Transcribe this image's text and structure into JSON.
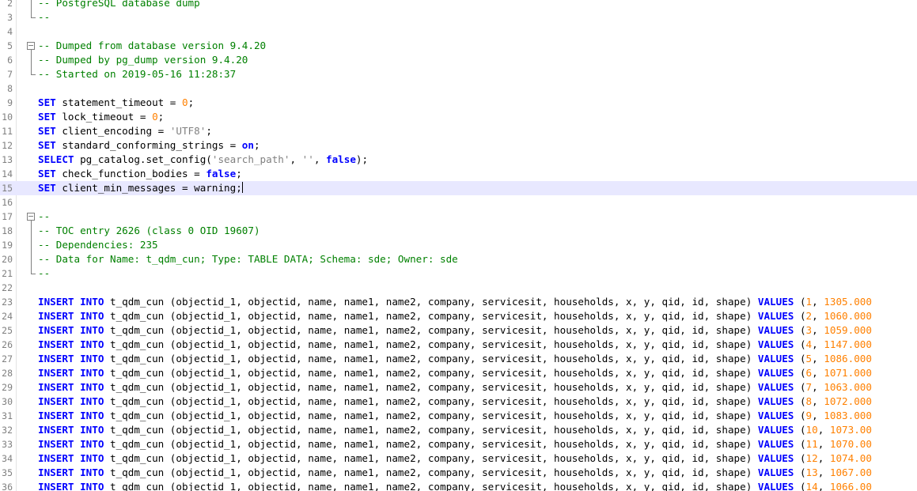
{
  "editor": {
    "language": "sql",
    "current_line": 15,
    "colors": {
      "keyword": "#0000ff",
      "comment": "#008000",
      "number": "#ff8000",
      "string": "#808080",
      "current_line_bg": "#e8e8ff",
      "line_number": "#808080"
    },
    "lines": [
      {
        "n": "2",
        "fold": "line",
        "tokens": [
          {
            "t": "-- PostgreSQL database dump",
            "c": "cm"
          }
        ]
      },
      {
        "n": "3",
        "fold": "end",
        "tokens": [
          {
            "t": "--",
            "c": "cm"
          }
        ]
      },
      {
        "n": "4",
        "fold": "",
        "tokens": []
      },
      {
        "n": "5",
        "fold": "box",
        "tokens": [
          {
            "t": "-- Dumped from database version 9.4.20",
            "c": "cm"
          }
        ]
      },
      {
        "n": "6",
        "fold": "line",
        "tokens": [
          {
            "t": "-- Dumped by pg_dump version 9.4.20",
            "c": "cm"
          }
        ]
      },
      {
        "n": "7",
        "fold": "end",
        "tokens": [
          {
            "t": "-- Started on 2019-05-16 11:28:37",
            "c": "cm"
          }
        ]
      },
      {
        "n": "8",
        "fold": "",
        "tokens": []
      },
      {
        "n": "9",
        "fold": "",
        "tokens": [
          {
            "t": "SET",
            "c": "kw"
          },
          {
            "t": " statement_timeout = ",
            "c": "pl"
          },
          {
            "t": "0",
            "c": "num"
          },
          {
            "t": ";",
            "c": "pl"
          }
        ]
      },
      {
        "n": "10",
        "fold": "",
        "tokens": [
          {
            "t": "SET",
            "c": "kw"
          },
          {
            "t": " lock_timeout = ",
            "c": "pl"
          },
          {
            "t": "0",
            "c": "num"
          },
          {
            "t": ";",
            "c": "pl"
          }
        ]
      },
      {
        "n": "11",
        "fold": "",
        "tokens": [
          {
            "t": "SET",
            "c": "kw"
          },
          {
            "t": " client_encoding = ",
            "c": "pl"
          },
          {
            "t": "'UTF8'",
            "c": "str"
          },
          {
            "t": ";",
            "c": "pl"
          }
        ]
      },
      {
        "n": "12",
        "fold": "",
        "tokens": [
          {
            "t": "SET",
            "c": "kw"
          },
          {
            "t": " standard_conforming_strings = ",
            "c": "pl"
          },
          {
            "t": "on",
            "c": "kw"
          },
          {
            "t": ";",
            "c": "pl"
          }
        ]
      },
      {
        "n": "13",
        "fold": "",
        "tokens": [
          {
            "t": "SELECT",
            "c": "kw"
          },
          {
            "t": " pg_catalog.set_config(",
            "c": "pl"
          },
          {
            "t": "'search_path'",
            "c": "str"
          },
          {
            "t": ", ",
            "c": "pl"
          },
          {
            "t": "''",
            "c": "str"
          },
          {
            "t": ", ",
            "c": "pl"
          },
          {
            "t": "false",
            "c": "kw"
          },
          {
            "t": ");",
            "c": "pl"
          }
        ]
      },
      {
        "n": "14",
        "fold": "",
        "tokens": [
          {
            "t": "SET",
            "c": "kw"
          },
          {
            "t": " check_function_bodies = ",
            "c": "pl"
          },
          {
            "t": "false",
            "c": "kw"
          },
          {
            "t": ";",
            "c": "pl"
          }
        ]
      },
      {
        "n": "15",
        "fold": "",
        "tokens": [
          {
            "t": "SET",
            "c": "kw"
          },
          {
            "t": " client_min_messages = warning;",
            "c": "pl"
          }
        ]
      },
      {
        "n": "16",
        "fold": "",
        "tokens": []
      },
      {
        "n": "17",
        "fold": "box",
        "tokens": [
          {
            "t": "--",
            "c": "cm"
          }
        ]
      },
      {
        "n": "18",
        "fold": "line",
        "tokens": [
          {
            "t": "-- TOC entry 2626 (class 0 OID 19607)",
            "c": "cm"
          }
        ]
      },
      {
        "n": "19",
        "fold": "line",
        "tokens": [
          {
            "t": "-- Dependencies: 235",
            "c": "cm"
          }
        ]
      },
      {
        "n": "20",
        "fold": "line",
        "tokens": [
          {
            "t": "-- Data for Name: t_qdm_cun; Type: TABLE DATA; Schema: sde; Owner: sde",
            "c": "cm"
          }
        ]
      },
      {
        "n": "21",
        "fold": "end",
        "tokens": [
          {
            "t": "--",
            "c": "cm"
          }
        ]
      },
      {
        "n": "22",
        "fold": "",
        "tokens": []
      },
      {
        "n": "23",
        "fold": "",
        "tokens": [
          {
            "t": "INSERT INTO",
            "c": "kw"
          },
          {
            "t": " t_qdm_cun (objectid_1, objectid, name, name1, name2, company, servicesit, households, x, y, qid, id, shape) ",
            "c": "pl"
          },
          {
            "t": "VALUES",
            "c": "kw"
          },
          {
            "t": " (",
            "c": "pl"
          },
          {
            "t": "1",
            "c": "num"
          },
          {
            "t": ", ",
            "c": "pl"
          },
          {
            "t": "1305.000",
            "c": "num"
          }
        ]
      },
      {
        "n": "24",
        "fold": "",
        "tokens": [
          {
            "t": "INSERT INTO",
            "c": "kw"
          },
          {
            "t": " t_qdm_cun (objectid_1, objectid, name, name1, name2, company, servicesit, households, x, y, qid, id, shape) ",
            "c": "pl"
          },
          {
            "t": "VALUES",
            "c": "kw"
          },
          {
            "t": " (",
            "c": "pl"
          },
          {
            "t": "2",
            "c": "num"
          },
          {
            "t": ", ",
            "c": "pl"
          },
          {
            "t": "1060.000",
            "c": "num"
          }
        ]
      },
      {
        "n": "25",
        "fold": "",
        "tokens": [
          {
            "t": "INSERT INTO",
            "c": "kw"
          },
          {
            "t": " t_qdm_cun (objectid_1, objectid, name, name1, name2, company, servicesit, households, x, y, qid, id, shape) ",
            "c": "pl"
          },
          {
            "t": "VALUES",
            "c": "kw"
          },
          {
            "t": " (",
            "c": "pl"
          },
          {
            "t": "3",
            "c": "num"
          },
          {
            "t": ", ",
            "c": "pl"
          },
          {
            "t": "1059.000",
            "c": "num"
          }
        ]
      },
      {
        "n": "26",
        "fold": "",
        "tokens": [
          {
            "t": "INSERT INTO",
            "c": "kw"
          },
          {
            "t": " t_qdm_cun (objectid_1, objectid, name, name1, name2, company, servicesit, households, x, y, qid, id, shape) ",
            "c": "pl"
          },
          {
            "t": "VALUES",
            "c": "kw"
          },
          {
            "t": " (",
            "c": "pl"
          },
          {
            "t": "4",
            "c": "num"
          },
          {
            "t": ", ",
            "c": "pl"
          },
          {
            "t": "1147.000",
            "c": "num"
          }
        ]
      },
      {
        "n": "27",
        "fold": "",
        "tokens": [
          {
            "t": "INSERT INTO",
            "c": "kw"
          },
          {
            "t": " t_qdm_cun (objectid_1, objectid, name, name1, name2, company, servicesit, households, x, y, qid, id, shape) ",
            "c": "pl"
          },
          {
            "t": "VALUES",
            "c": "kw"
          },
          {
            "t": " (",
            "c": "pl"
          },
          {
            "t": "5",
            "c": "num"
          },
          {
            "t": ", ",
            "c": "pl"
          },
          {
            "t": "1086.000",
            "c": "num"
          }
        ]
      },
      {
        "n": "28",
        "fold": "",
        "tokens": [
          {
            "t": "INSERT INTO",
            "c": "kw"
          },
          {
            "t": " t_qdm_cun (objectid_1, objectid, name, name1, name2, company, servicesit, households, x, y, qid, id, shape) ",
            "c": "pl"
          },
          {
            "t": "VALUES",
            "c": "kw"
          },
          {
            "t": " (",
            "c": "pl"
          },
          {
            "t": "6",
            "c": "num"
          },
          {
            "t": ", ",
            "c": "pl"
          },
          {
            "t": "1071.000",
            "c": "num"
          }
        ]
      },
      {
        "n": "29",
        "fold": "",
        "tokens": [
          {
            "t": "INSERT INTO",
            "c": "kw"
          },
          {
            "t": " t_qdm_cun (objectid_1, objectid, name, name1, name2, company, servicesit, households, x, y, qid, id, shape) ",
            "c": "pl"
          },
          {
            "t": "VALUES",
            "c": "kw"
          },
          {
            "t": " (",
            "c": "pl"
          },
          {
            "t": "7",
            "c": "num"
          },
          {
            "t": ", ",
            "c": "pl"
          },
          {
            "t": "1063.000",
            "c": "num"
          }
        ]
      },
      {
        "n": "30",
        "fold": "",
        "tokens": [
          {
            "t": "INSERT INTO",
            "c": "kw"
          },
          {
            "t": " t_qdm_cun (objectid_1, objectid, name, name1, name2, company, servicesit, households, x, y, qid, id, shape) ",
            "c": "pl"
          },
          {
            "t": "VALUES",
            "c": "kw"
          },
          {
            "t": " (",
            "c": "pl"
          },
          {
            "t": "8",
            "c": "num"
          },
          {
            "t": ", ",
            "c": "pl"
          },
          {
            "t": "1072.000",
            "c": "num"
          }
        ]
      },
      {
        "n": "31",
        "fold": "",
        "tokens": [
          {
            "t": "INSERT INTO",
            "c": "kw"
          },
          {
            "t": " t_qdm_cun (objectid_1, objectid, name, name1, name2, company, servicesit, households, x, y, qid, id, shape) ",
            "c": "pl"
          },
          {
            "t": "VALUES",
            "c": "kw"
          },
          {
            "t": " (",
            "c": "pl"
          },
          {
            "t": "9",
            "c": "num"
          },
          {
            "t": ", ",
            "c": "pl"
          },
          {
            "t": "1083.000",
            "c": "num"
          }
        ]
      },
      {
        "n": "32",
        "fold": "",
        "tokens": [
          {
            "t": "INSERT INTO",
            "c": "kw"
          },
          {
            "t": " t_qdm_cun (objectid_1, objectid, name, name1, name2, company, servicesit, households, x, y, qid, id, shape) ",
            "c": "pl"
          },
          {
            "t": "VALUES",
            "c": "kw"
          },
          {
            "t": " (",
            "c": "pl"
          },
          {
            "t": "10",
            "c": "num"
          },
          {
            "t": ", ",
            "c": "pl"
          },
          {
            "t": "1073.00",
            "c": "num"
          }
        ]
      },
      {
        "n": "33",
        "fold": "",
        "tokens": [
          {
            "t": "INSERT INTO",
            "c": "kw"
          },
          {
            "t": " t_qdm_cun (objectid_1, objectid, name, name1, name2, company, servicesit, households, x, y, qid, id, shape) ",
            "c": "pl"
          },
          {
            "t": "VALUES",
            "c": "kw"
          },
          {
            "t": " (",
            "c": "pl"
          },
          {
            "t": "11",
            "c": "num"
          },
          {
            "t": ", ",
            "c": "pl"
          },
          {
            "t": "1070.00",
            "c": "num"
          }
        ]
      },
      {
        "n": "34",
        "fold": "",
        "tokens": [
          {
            "t": "INSERT INTO",
            "c": "kw"
          },
          {
            "t": " t_qdm_cun (objectid_1, objectid, name, name1, name2, company, servicesit, households, x, y, qid, id, shape) ",
            "c": "pl"
          },
          {
            "t": "VALUES",
            "c": "kw"
          },
          {
            "t": " (",
            "c": "pl"
          },
          {
            "t": "12",
            "c": "num"
          },
          {
            "t": ", ",
            "c": "pl"
          },
          {
            "t": "1074.00",
            "c": "num"
          }
        ]
      },
      {
        "n": "35",
        "fold": "",
        "tokens": [
          {
            "t": "INSERT INTO",
            "c": "kw"
          },
          {
            "t": " t_qdm_cun (objectid_1, objectid, name, name1, name2, company, servicesit, households, x, y, qid, id, shape) ",
            "c": "pl"
          },
          {
            "t": "VALUES",
            "c": "kw"
          },
          {
            "t": " (",
            "c": "pl"
          },
          {
            "t": "13",
            "c": "num"
          },
          {
            "t": ", ",
            "c": "pl"
          },
          {
            "t": "1067.00",
            "c": "num"
          }
        ]
      },
      {
        "n": "36",
        "fold": "",
        "tokens": [
          {
            "t": "INSERT INTO",
            "c": "kw"
          },
          {
            "t": " t_qdm_cun (objectid_1, objectid, name, name1, name2, company, servicesit, households, x, y, qid, id, shape) ",
            "c": "pl"
          },
          {
            "t": "VALUES",
            "c": "kw"
          },
          {
            "t": " (",
            "c": "pl"
          },
          {
            "t": "14",
            "c": "num"
          },
          {
            "t": ", ",
            "c": "pl"
          },
          {
            "t": "1066.00",
            "c": "num"
          }
        ]
      }
    ]
  }
}
